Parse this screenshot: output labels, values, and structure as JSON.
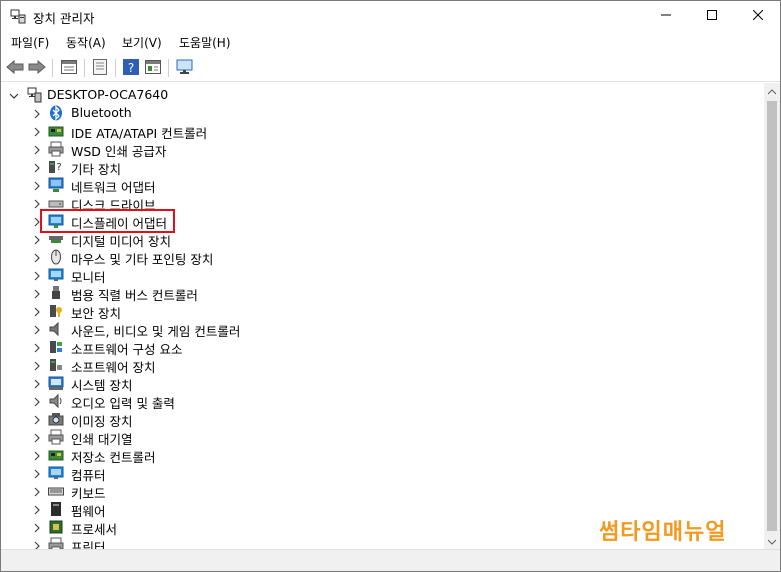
{
  "window": {
    "title": "장치 관리자",
    "app_icon": "device-manager-icon",
    "controls": {
      "minimize": "minimize-icon",
      "maximize": "maximize-icon",
      "close": "close-icon"
    }
  },
  "menu": {
    "items": [
      {
        "label": "파일(F)"
      },
      {
        "label": "동작(A)"
      },
      {
        "label": "보기(V)"
      },
      {
        "label": "도움말(H)"
      }
    ]
  },
  "toolbar": {
    "buttons": [
      "back-icon",
      "forward-icon",
      "properties-icon",
      "update-driver-icon",
      "help-icon",
      "view-icon",
      "scan-hardware-icon"
    ]
  },
  "tree": {
    "root": {
      "label": "DESKTOP-OCA7640",
      "expanded": true
    },
    "items": [
      {
        "label": "Bluetooth",
        "icon": "bluetooth-icon"
      },
      {
        "label": "IDE ATA/ATAPI 컨트롤러",
        "icon": "ide-controller-icon"
      },
      {
        "label": "WSD 인쇄 공급자",
        "icon": "printer-icon"
      },
      {
        "label": "기타 장치",
        "icon": "unknown-device-icon"
      },
      {
        "label": "네트워크 어댑터",
        "icon": "network-adapter-icon"
      },
      {
        "label": "디스크 드라이브",
        "icon": "disk-drive-icon"
      },
      {
        "label": "디스플레이 어댑터",
        "icon": "display-adapter-icon",
        "highlighted": true
      },
      {
        "label": "디지털 미디어 장치",
        "icon": "digital-media-icon"
      },
      {
        "label": "마우스 및 기타 포인팅 장치",
        "icon": "mouse-icon"
      },
      {
        "label": "모니터",
        "icon": "monitor-icon"
      },
      {
        "label": "범용 직렬 버스 컨트롤러",
        "icon": "usb-icon"
      },
      {
        "label": "보안 장치",
        "icon": "security-device-icon"
      },
      {
        "label": "사운드, 비디오 및 게임 컨트롤러",
        "icon": "sound-icon"
      },
      {
        "label": "소프트웨어 구성 요소",
        "icon": "software-component-icon"
      },
      {
        "label": "소프트웨어 장치",
        "icon": "software-device-icon"
      },
      {
        "label": "시스템 장치",
        "icon": "system-device-icon"
      },
      {
        "label": "오디오 입력 및 출력",
        "icon": "audio-io-icon"
      },
      {
        "label": "이미징 장치",
        "icon": "imaging-device-icon"
      },
      {
        "label": "인쇄 대기열",
        "icon": "print-queue-icon"
      },
      {
        "label": "저장소 컨트롤러",
        "icon": "storage-controller-icon"
      },
      {
        "label": "컴퓨터",
        "icon": "computer-icon"
      },
      {
        "label": "키보드",
        "icon": "keyboard-icon"
      },
      {
        "label": "펌웨어",
        "icon": "firmware-icon"
      },
      {
        "label": "프로세서",
        "icon": "processor-icon"
      },
      {
        "label": "프린터",
        "icon": "printer-icon"
      }
    ]
  },
  "watermark": {
    "text": "썸타임매뉴얼"
  },
  "colors": {
    "highlight_border": "#e0101a",
    "watermark": "#f39a1e"
  }
}
